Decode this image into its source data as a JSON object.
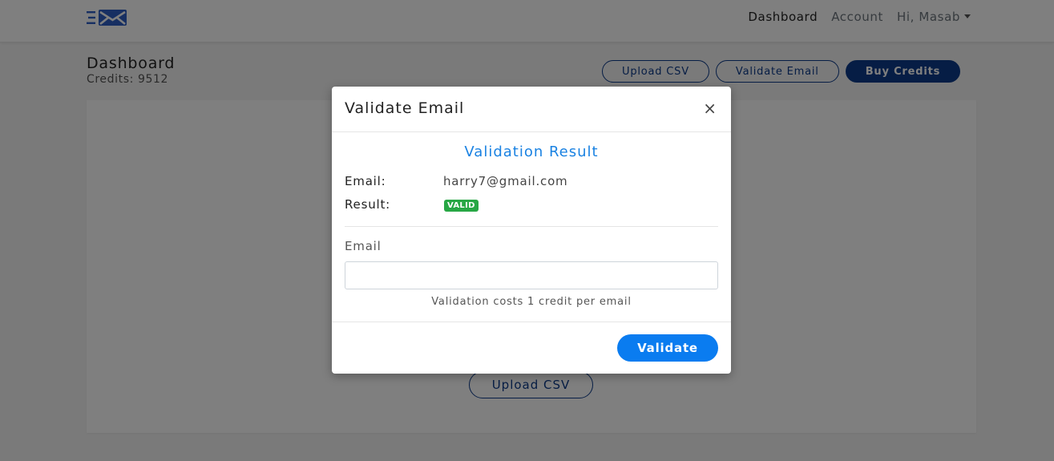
{
  "navbar": {
    "logo_icon": "mail-logo-icon",
    "links": [
      "Dashboard",
      "Account"
    ],
    "user_menu": "Hi, Masab"
  },
  "page": {
    "title": "Dashboard",
    "credits": "Credits: 9512",
    "actions": {
      "upload_csv": "Upload CSV",
      "validate_email": "Validate Email",
      "buy_credits": "Buy Credits"
    },
    "card_upload_label": "Upload CSV"
  },
  "modal": {
    "title": "Validate Email",
    "close_symbol": "×",
    "result_heading": "Validation Result",
    "email_label": "Email:",
    "email_value": "harry7@gmail.com",
    "result_label": "Result:",
    "result_badge": "VALID",
    "field_label": "Email",
    "field_value": "",
    "help_text": "Validation costs 1 credit per email",
    "submit_label": "Validate"
  },
  "colors": {
    "brand": "#0d3b8a",
    "accent": "#0a7cf0",
    "heading_blue": "#1a82e2",
    "success": "#28a745"
  }
}
